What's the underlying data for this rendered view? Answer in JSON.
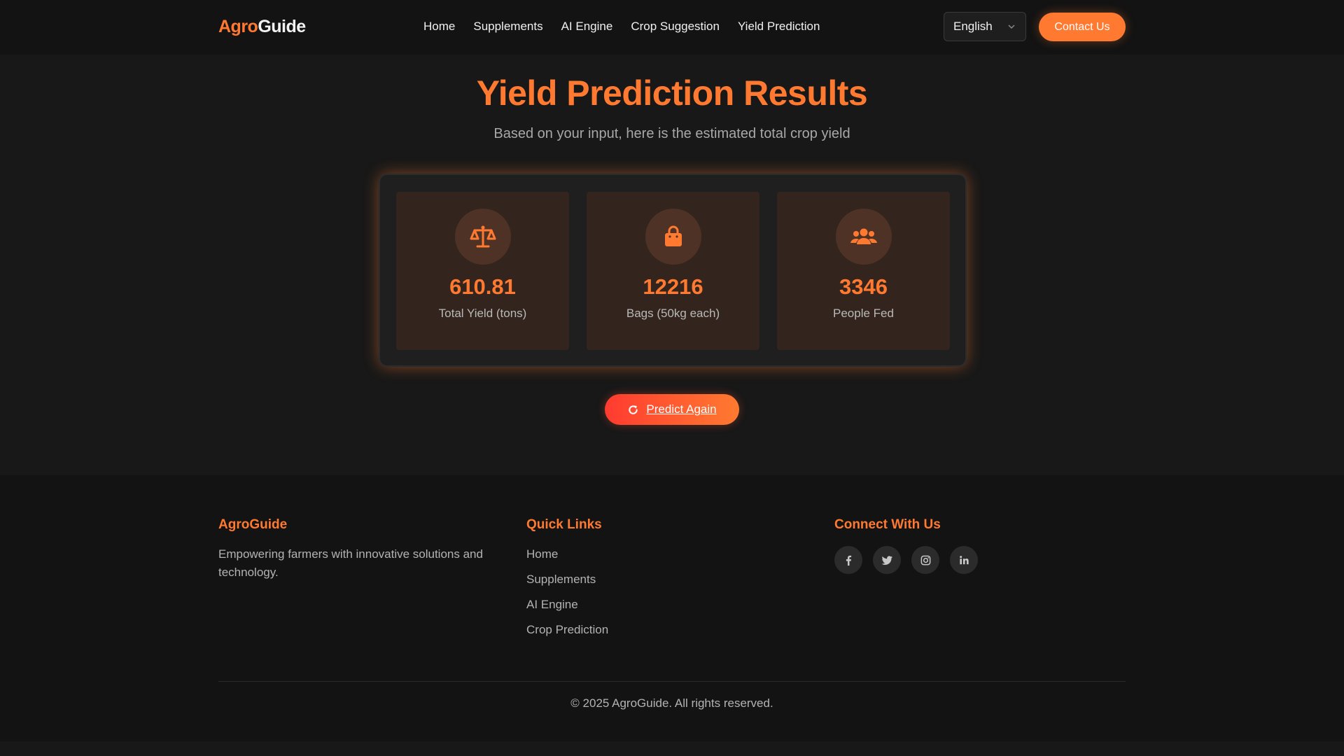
{
  "brand": {
    "part1": "Agro",
    "part2": "Guide"
  },
  "nav": {
    "links": [
      "Home",
      "Supplements",
      "AI Engine",
      "Crop Suggestion",
      "Yield Prediction"
    ],
    "language": "English",
    "contact_label": "Contact Us"
  },
  "hero": {
    "title": "Yield Prediction Results",
    "subtitle": "Based on your input, here is the estimated total crop yield"
  },
  "stats": [
    {
      "icon": "scale-icon",
      "value": "610.81",
      "label": "Total Yield (tons)"
    },
    {
      "icon": "shopping-bag-icon",
      "value": "12216",
      "label": "Bags (50kg each)"
    },
    {
      "icon": "users-icon",
      "value": "3346",
      "label": "People Fed"
    }
  ],
  "predict_again_label": "Predict Again",
  "footer": {
    "brand_title": "AgroGuide",
    "description": "Empowering farmers with innovative solutions and technology.",
    "quick_links_title": "Quick Links",
    "quick_links": [
      "Home",
      "Supplements",
      "AI Engine",
      "Crop Prediction"
    ],
    "connect_title": "Connect With Us",
    "social": [
      "facebook-icon",
      "twitter-icon",
      "instagram-icon",
      "linkedin-icon"
    ],
    "copyright": "© 2025 AgroGuide. All rights reserved."
  },
  "colors": {
    "accent": "#ff7a30",
    "background": "#181818",
    "gradient_start": "#ff3b30"
  }
}
